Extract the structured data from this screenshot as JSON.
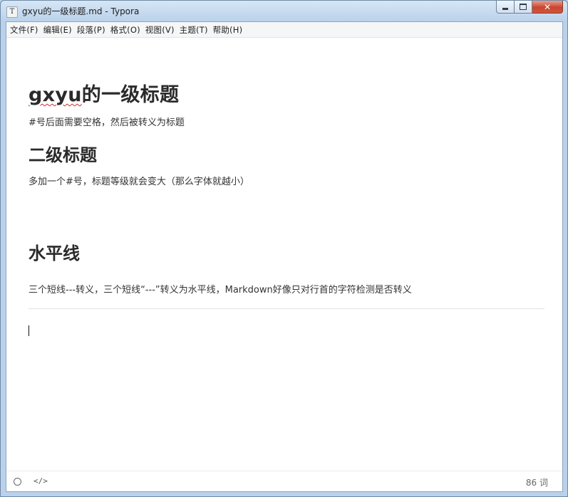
{
  "window": {
    "title": "gxyu的一级标题.md - Typora",
    "icon_letter": "T",
    "controls": {
      "minimize": "minimize-icon",
      "maximize": "maximize-icon",
      "close": "✕"
    }
  },
  "menubar": {
    "items": [
      "文件(F)",
      "编辑(E)",
      "段落(P)",
      "格式(O)",
      "视图(V)",
      "主题(T)",
      "帮助(H)"
    ]
  },
  "document": {
    "h1_word": "gxyu",
    "h1_rest": "的一级标题",
    "p1": "#号后面需要空格，然后被转义为标题",
    "h2_1": "二级标题",
    "p2": "多加一个#号，标题等级就会变大（那么字体就越小）",
    "h2_2": "水平线",
    "p3": "三个短线---转义，三个短线“---”转义为水平线，Markdown好像只对行首的字符检测是否转义"
  },
  "statusbar": {
    "code_toggle": "</>",
    "word_count": "86 词"
  },
  "colors": {
    "window_frame": "#b9d1ea",
    "close_button": "#c9452f",
    "text": "#333333",
    "spell_underline": "#d52b2b"
  }
}
